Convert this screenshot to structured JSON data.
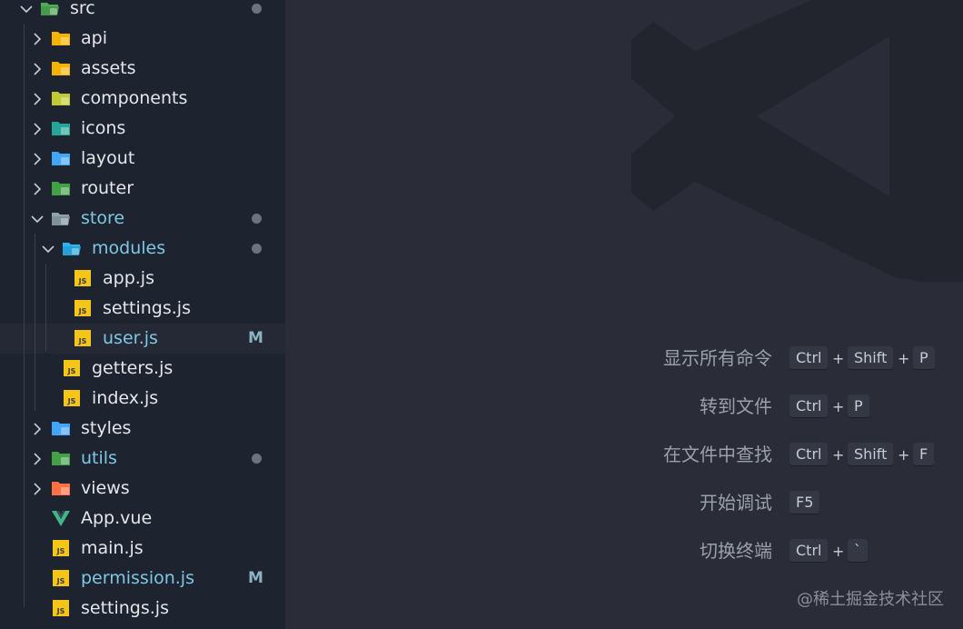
{
  "explorer": {
    "items": [
      {
        "label": "src",
        "depth": 0,
        "type": "folder",
        "open": true,
        "icon": "src-folder-icon",
        "modified_dot": true
      },
      {
        "label": "api",
        "depth": 1,
        "type": "folder",
        "open": false,
        "icon": "api-folder-icon"
      },
      {
        "label": "assets",
        "depth": 1,
        "type": "folder",
        "open": false,
        "icon": "assets-folder-icon"
      },
      {
        "label": "components",
        "depth": 1,
        "type": "folder",
        "open": false,
        "icon": "components-folder-icon"
      },
      {
        "label": "icons",
        "depth": 1,
        "type": "folder",
        "open": false,
        "icon": "icons-folder-icon"
      },
      {
        "label": "layout",
        "depth": 1,
        "type": "folder",
        "open": false,
        "icon": "layout-folder-icon"
      },
      {
        "label": "router",
        "depth": 1,
        "type": "folder",
        "open": false,
        "icon": "router-folder-icon"
      },
      {
        "label": "store",
        "depth": 1,
        "type": "folder",
        "open": true,
        "icon": "store-folder-icon",
        "modified": true,
        "modified_dot": true
      },
      {
        "label": "modules",
        "depth": 2,
        "type": "folder",
        "open": true,
        "icon": "modules-folder-icon",
        "modified": true,
        "modified_dot": true
      },
      {
        "label": "app.js",
        "depth": 3,
        "type": "file",
        "icon": "js-file-icon"
      },
      {
        "label": "settings.js",
        "depth": 3,
        "type": "file",
        "icon": "js-file-icon"
      },
      {
        "label": "user.js",
        "depth": 3,
        "type": "file",
        "icon": "js-file-icon",
        "modified": true,
        "badge": "M"
      },
      {
        "label": "getters.js",
        "depth": 2,
        "type": "file",
        "icon": "js-file-icon"
      },
      {
        "label": "index.js",
        "depth": 2,
        "type": "file",
        "icon": "js-file-icon"
      },
      {
        "label": "styles",
        "depth": 1,
        "type": "folder",
        "open": false,
        "icon": "styles-folder-icon"
      },
      {
        "label": "utils",
        "depth": 1,
        "type": "folder",
        "open": false,
        "icon": "utils-folder-icon",
        "modified": true,
        "modified_dot": true
      },
      {
        "label": "views",
        "depth": 1,
        "type": "folder",
        "open": false,
        "icon": "views-folder-icon"
      },
      {
        "label": "App.vue",
        "depth": 1,
        "type": "file",
        "icon": "vue-file-icon"
      },
      {
        "label": "main.js",
        "depth": 1,
        "type": "file",
        "icon": "js-file-icon"
      },
      {
        "label": "permission.js",
        "depth": 1,
        "type": "file",
        "icon": "js-file-icon",
        "modified": true,
        "badge": "M"
      },
      {
        "label": "settings.js",
        "depth": 1,
        "type": "file",
        "icon": "js-file-icon"
      }
    ]
  },
  "shortcuts": [
    {
      "label": "显示所有命令",
      "keys": [
        "Ctrl",
        "Shift",
        "P"
      ]
    },
    {
      "label": "转到文件",
      "keys": [
        "Ctrl",
        "P"
      ]
    },
    {
      "label": "在文件中查找",
      "keys": [
        "Ctrl",
        "Shift",
        "F"
      ]
    },
    {
      "label": "开始调试",
      "keys": [
        "F5"
      ]
    },
    {
      "label": "切换终端",
      "keys": [
        "Ctrl",
        "`"
      ]
    }
  ],
  "plus_sign": "+",
  "credit": "@稀土掘金技术社区",
  "colors": {
    "sidebar_bg": "#1e2330",
    "editor_bg": "#2a2d38",
    "modified_text": "#7ec8e3",
    "logo_watermark": "#22252e"
  }
}
